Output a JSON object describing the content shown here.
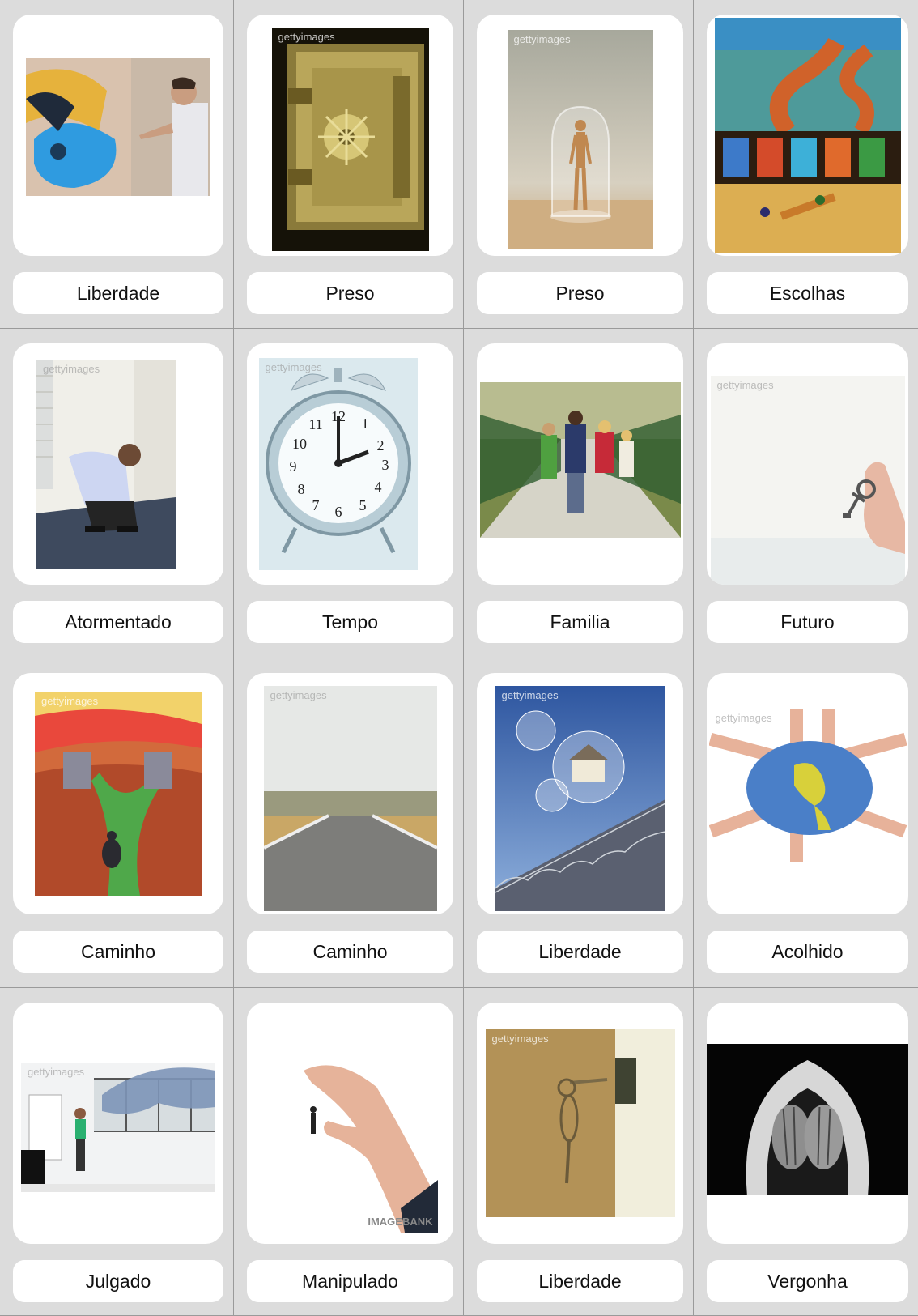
{
  "watermark": "gettyimages",
  "watermark_bottom": "IMAGEBANK",
  "cards": [
    {
      "label": "Liberdade",
      "image": "graffiti-bird-man-photo"
    },
    {
      "label": "Preso",
      "image": "bank-vault-door-photo"
    },
    {
      "label": "Preso",
      "image": "mannequin-in-glass-dome-photo"
    },
    {
      "label": "Escolhas",
      "image": "winding-roads-painting"
    },
    {
      "label": "Atormentado",
      "image": "man-crouching-in-corner-photo"
    },
    {
      "label": "Tempo",
      "image": "alarm-clock-photo"
    },
    {
      "label": "Familia",
      "image": "family-walking-bridge-photo"
    },
    {
      "label": "Futuro",
      "image": "hand-holding-key-photo"
    },
    {
      "label": "Caminho",
      "image": "crossroads-painting"
    },
    {
      "label": "Caminho",
      "image": "split-road-photo"
    },
    {
      "label": "Liberdade",
      "image": "houses-in-bubbles-photo"
    },
    {
      "label": "Acolhido",
      "image": "joined-painted-hands-photo"
    },
    {
      "label": "Julgado",
      "image": "giant-hand-over-man-photo"
    },
    {
      "label": "Manipulado",
      "image": "fingers-holding-tiny-man-photo"
    },
    {
      "label": "Liberdade",
      "image": "key-in-door-lock-photo"
    },
    {
      "label": "Vergonha",
      "image": "hooded-face-in-hands-photo"
    }
  ]
}
